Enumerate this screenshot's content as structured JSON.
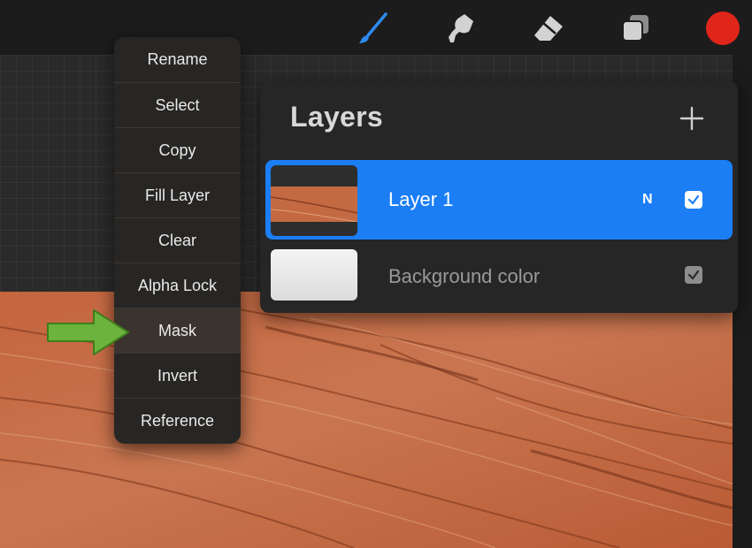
{
  "toolbar": {
    "tools": [
      {
        "name": "brush",
        "icon": "brush-icon"
      },
      {
        "name": "smudge",
        "icon": "smudge-icon"
      },
      {
        "name": "eraser",
        "icon": "eraser-icon"
      },
      {
        "name": "layers",
        "icon": "layers-icon"
      }
    ],
    "active_color": "#e0251b",
    "accent": "#2d8bf0"
  },
  "context_menu": {
    "items": [
      {
        "label": "Rename"
      },
      {
        "label": "Select"
      },
      {
        "label": "Copy"
      },
      {
        "label": "Fill Layer"
      },
      {
        "label": "Clear"
      },
      {
        "label": "Alpha Lock"
      },
      {
        "label": "Mask",
        "highlighted": true
      },
      {
        "label": "Invert"
      },
      {
        "label": "Reference"
      }
    ]
  },
  "layers_panel": {
    "title": "Layers",
    "add_icon": "plus-icon",
    "layers": [
      {
        "name": "Layer 1",
        "blend_mode": "N",
        "visible": true,
        "selected": true
      },
      {
        "name": "Background color",
        "visible": true,
        "selected": false
      }
    ]
  },
  "annotation": {
    "type": "arrow",
    "color": "#6bb33c",
    "points_to": "Mask"
  }
}
